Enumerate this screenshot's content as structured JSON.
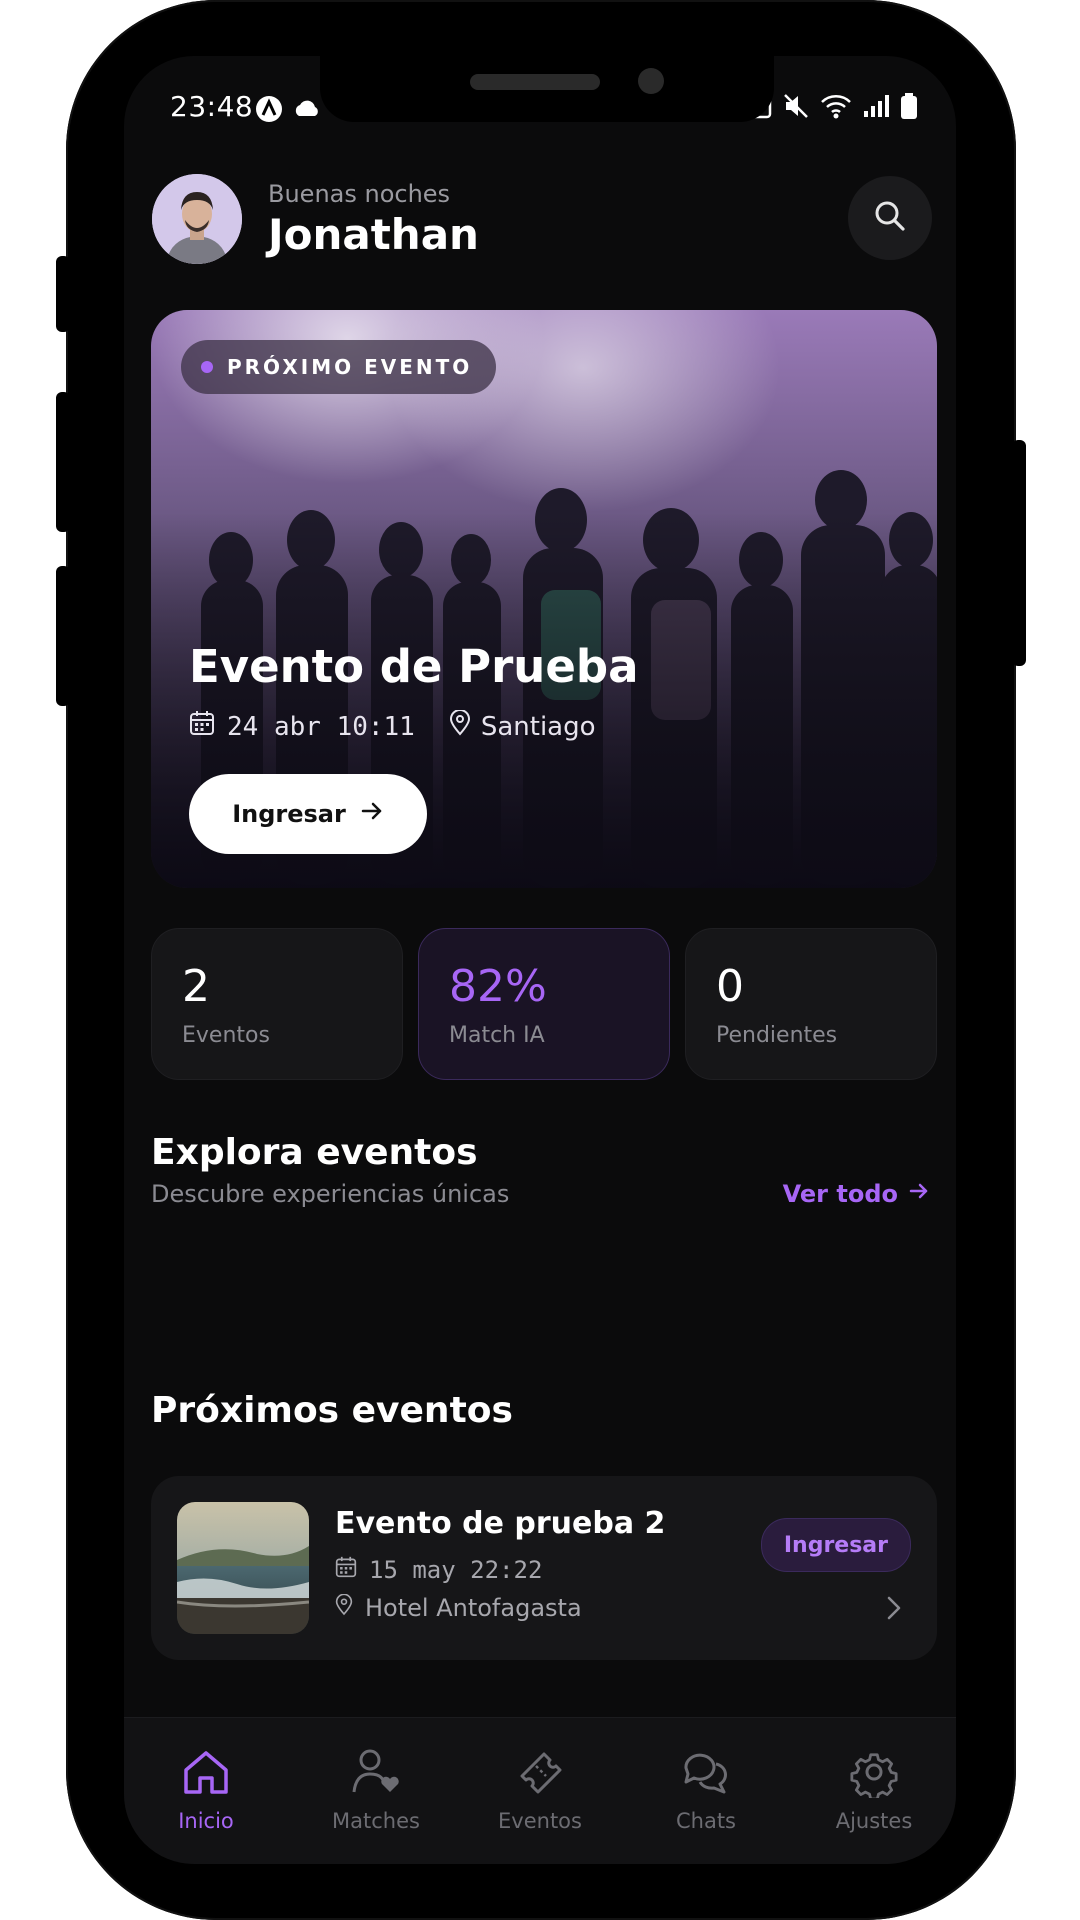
{
  "status_bar": {
    "time": "23:48"
  },
  "header": {
    "greeting": "Buenas noches",
    "name": "Jonathan"
  },
  "hero": {
    "badge": "PRÓXIMO EVENTO",
    "title": "Evento de Prueba",
    "date": "24 abr 10:11",
    "location": "Santiago",
    "button_label": "Ingresar"
  },
  "stats": [
    {
      "value": "2",
      "label": "Eventos"
    },
    {
      "value": "82%",
      "label": "Match IA"
    },
    {
      "value": "0",
      "label": "Pendientes"
    }
  ],
  "explore": {
    "title": "Explora eventos",
    "subtitle": "Descubre experiencias únicas",
    "see_all": "Ver todo"
  },
  "upcoming": {
    "title": "Próximos eventos",
    "items": [
      {
        "title": "Evento de prueba 2",
        "date": "15 may 22:22",
        "location": "Hotel Antofagasta",
        "button_label": "Ingresar"
      }
    ]
  },
  "tabbar": {
    "items": [
      {
        "label": "Inicio",
        "icon": "home-icon",
        "active": true
      },
      {
        "label": "Matches",
        "icon": "user-heart-icon",
        "active": false
      },
      {
        "label": "Eventos",
        "icon": "ticket-icon",
        "active": false
      },
      {
        "label": "Chats",
        "icon": "chat-bubbles-icon",
        "active": false
      },
      {
        "label": "Ajustes",
        "icon": "gear-icon",
        "active": false
      }
    ]
  },
  "colors": {
    "accent": "#a766f5",
    "background": "#0b0b0c",
    "card": "#161618"
  }
}
